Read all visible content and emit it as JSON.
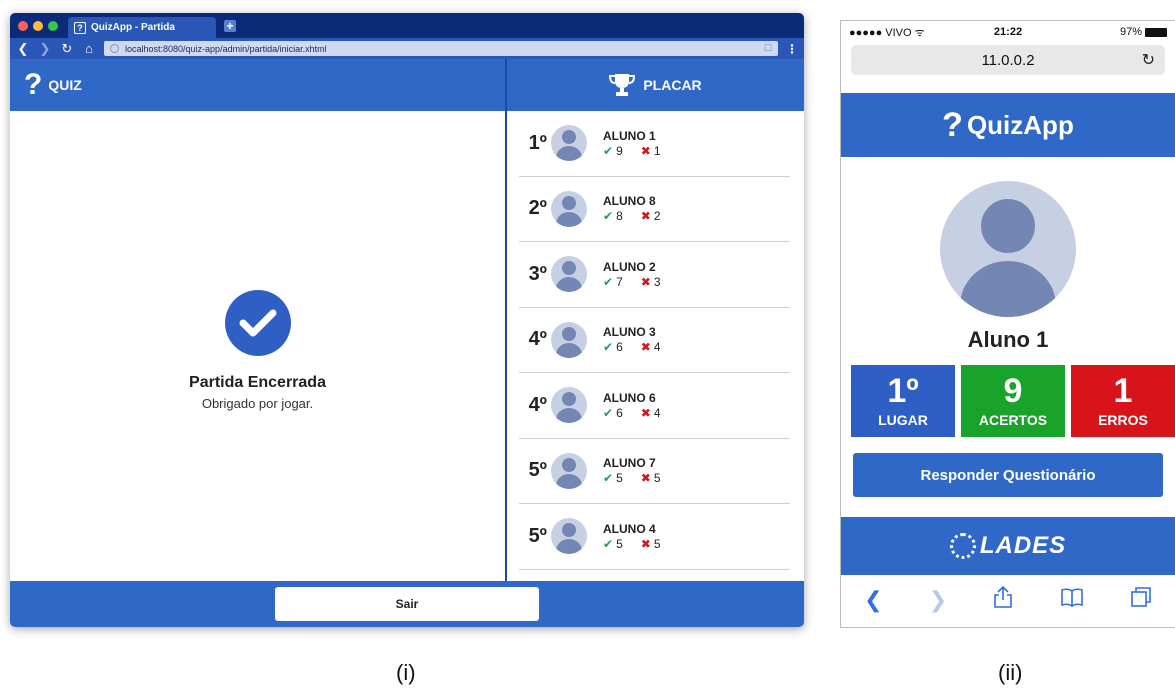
{
  "desktop": {
    "tab_title": "QuizApp - Partida",
    "tab_icon": "?",
    "url": "localhost:8080/quiz-app/admin/partida/iniciar.xhtml",
    "quiz_header": "QUIZ",
    "quiz_icon": "?",
    "status_title": "Partida Encerrada",
    "status_subtitle": "Obrigado por jogar.",
    "scoreboard_header": "PLACAR",
    "scoreboard": [
      {
        "rank": "1º",
        "name": "ALUNO 1",
        "correct": "9",
        "wrong": "1"
      },
      {
        "rank": "2º",
        "name": "ALUNO 8",
        "correct": "8",
        "wrong": "2"
      },
      {
        "rank": "3º",
        "name": "ALUNO 2",
        "correct": "7",
        "wrong": "3"
      },
      {
        "rank": "4º",
        "name": "ALUNO 3",
        "correct": "6",
        "wrong": "4"
      },
      {
        "rank": "4º",
        "name": "ALUNO 6",
        "correct": "6",
        "wrong": "4"
      },
      {
        "rank": "5º",
        "name": "ALUNO 7",
        "correct": "5",
        "wrong": "5"
      },
      {
        "rank": "5º",
        "name": "ALUNO 4",
        "correct": "5",
        "wrong": "5"
      }
    ],
    "exit_label": "Sair",
    "caption": "(i)"
  },
  "mobile": {
    "carrier": "●●●●● VIVO ᯤ",
    "time": "21:22",
    "battery": "97%",
    "url": "11.0.0.2",
    "app_title": "QuizApp",
    "app_icon": "?",
    "student_name": "Aluno 1",
    "place_value": "1º",
    "place_label": "LUGAR",
    "correct_value": "9",
    "correct_label": "ACERTOS",
    "wrong_value": "1",
    "wrong_label": "ERROS",
    "answer_button": "Responder Questionário",
    "footer_logo": "LADES",
    "caption": "(ii)"
  },
  "colors": {
    "primary": "#3068c8",
    "titlebar": "#0b2a78",
    "correct": "#1aa32a",
    "wrong": "#d8141b"
  }
}
